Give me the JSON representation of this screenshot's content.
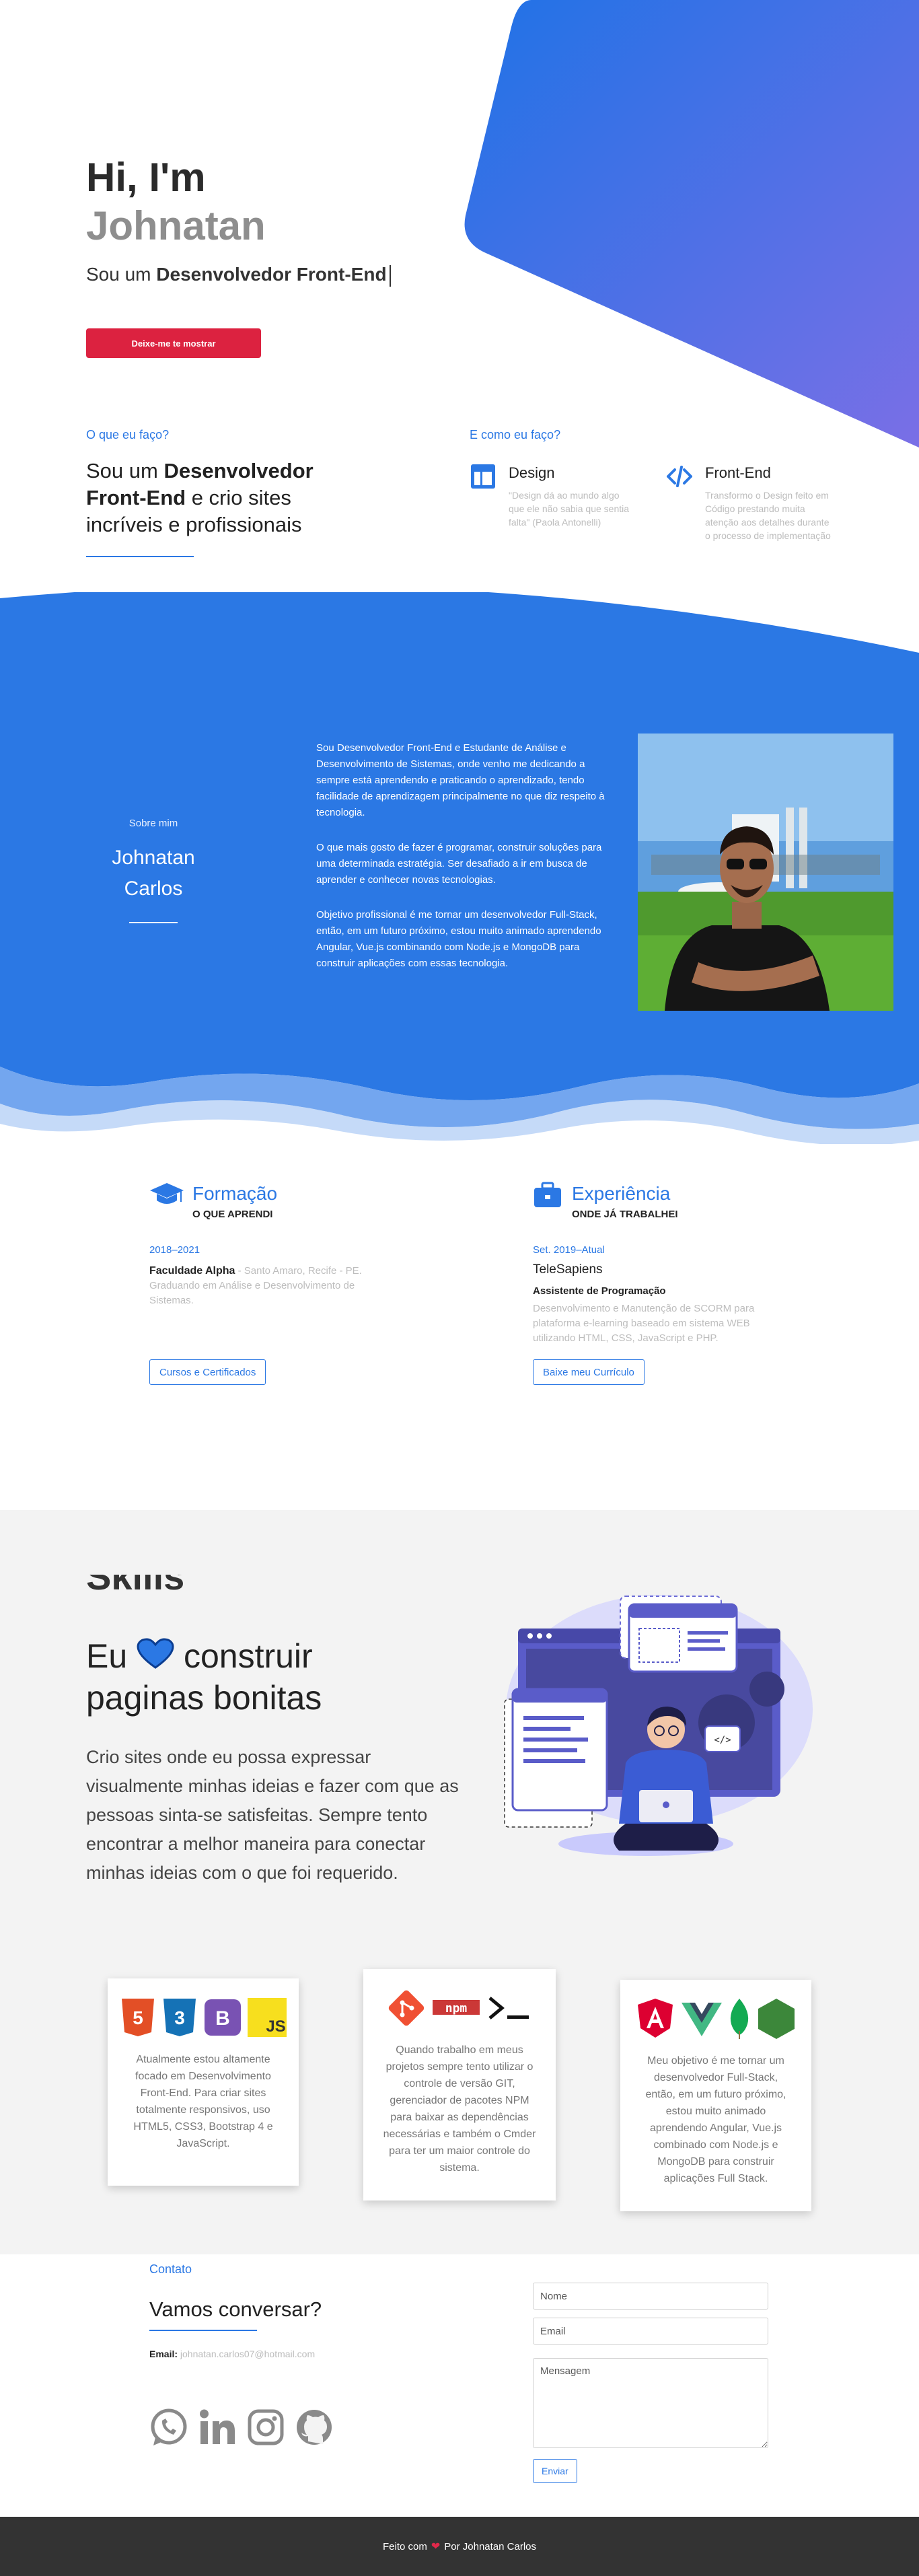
{
  "hero": {
    "greeting": "Hi, I'm",
    "name": "Johnatan",
    "role_prefix": "Sou um ",
    "role_bold": "Desenvolvedor Front-End",
    "cta": "Deixe-me te mostrar"
  },
  "what": {
    "label": "O que eu faço?",
    "title_prefix": "Sou um ",
    "title_bold": "Desenvolvedor Front-End",
    "title_suffix": " e crio sites incríveis e profissionais"
  },
  "how": {
    "label": "E como eu faço?",
    "items": [
      {
        "icon": "layout-icon",
        "title": "Design",
        "desc": "\"Design dá ao mundo algo que ele não sabia que sentia falta\" (Paola Antonelli)"
      },
      {
        "icon": "code-icon",
        "title": "Front-End",
        "desc": "Transformo o Design feito em Código prestando muita atenção aos detalhes durante o processo de implementação"
      }
    ]
  },
  "about": {
    "label": "Sobre mim",
    "name": "Johnatan Carlos",
    "paragraphs": [
      "Sou Desenvolvedor Front-End e Estudante de Análise e Desenvolvimento de Sistemas, onde venho me dedicando a sempre está aprendendo e praticando o aprendizado, tendo facilidade de aprendizagem principalmente no que diz respeito à tecnologia.",
      "O que mais gosto de fazer é programar, construir soluções para uma determinada estratégia. Ser desafiado a ir em busca de aprender e conhecer novas tecnologias.",
      "Objetivo profissional é me tornar um desenvolvedor Full-Stack, então, em um futuro próximo, estou muito animado aprendendo Angular, Vue.js combinando com Node.js e MongoDB para construir aplicações com essas tecnologia."
    ],
    "accent_color": "#2b78e4"
  },
  "education": {
    "title": "Formação",
    "subtitle": "O QUE APRENDI",
    "date": "2018–2021",
    "institution": "Faculdade Alpha",
    "detail": " - Santo Amaro, Recife - PE. Graduando em Análise e Desenvolvimento de Sistemas.",
    "button": "Cursos e Certificados"
  },
  "experience": {
    "title": "Experiência",
    "subtitle": "ONDE JÁ TRABALHEI",
    "date": "Set. 2019–Atual",
    "company": "TeleSapiens",
    "position": "Assistente de Programação",
    "detail": "Desenvolvimento e Manutenção de SCORM para plataforma e-learning baseado em sistema WEB utilizando HTML, CSS, JavaScript e PHP.",
    "button": "Baixe meu Currículo"
  },
  "skills": {
    "heading": "Skills",
    "love_prefix": "Eu ",
    "love_suffix": " construir",
    "love_line2": "paginas bonitas",
    "text": "Crio sites onde eu possa expressar visualmente minhas ideias e fazer com que as pessoas sinta-se satisfeitas. Sempre tento encontrar a melhor maneira para conectar minhas ideias com o que foi requerido.",
    "cards": [
      {
        "icons": [
          "html5-icon",
          "css3-icon",
          "bootstrap-icon",
          "javascript-icon"
        ],
        "text": "Atualmente estou altamente focado em Desenvolvimento Front-End. Para criar sites totalmente responsivos, uso HTML5, CSS3, Bootstrap 4 e JavaScript."
      },
      {
        "icons": [
          "git-icon",
          "npm-icon",
          "terminal-icon"
        ],
        "text": "Quando trabalho em meus projetos sempre tento utilizar o controle de versão GIT, gerenciador de pacotes NPM para baixar as dependências necessárias e também o Cmder para ter um maior controle do sistema."
      },
      {
        "icons": [
          "angular-icon",
          "vue-icon",
          "mongodb-icon",
          "nodejs-icon"
        ],
        "text": "Meu objetivo é me tornar um desenvolvedor Full-Stack, então, em um futuro próximo, estou muito animado aprendendo Angular, Vue.js combinado com Node.js e MongoDB para construir aplicações Full Stack."
      }
    ]
  },
  "contact": {
    "label": "Contato",
    "title": "Vamos conversar?",
    "email_label": "Email:",
    "email": " johnatan.carlos07@hotmail.com",
    "socials": [
      "whatsapp-icon",
      "linkedin-icon",
      "instagram-icon",
      "github-icon"
    ],
    "name_placeholder": "Nome",
    "email_placeholder": "Email",
    "message_placeholder": "Mensagem",
    "submit": "Enviar"
  },
  "footer": {
    "prefix": "Feito com",
    "heart": "❤",
    "suffix": "Por Johnatan Carlos"
  }
}
